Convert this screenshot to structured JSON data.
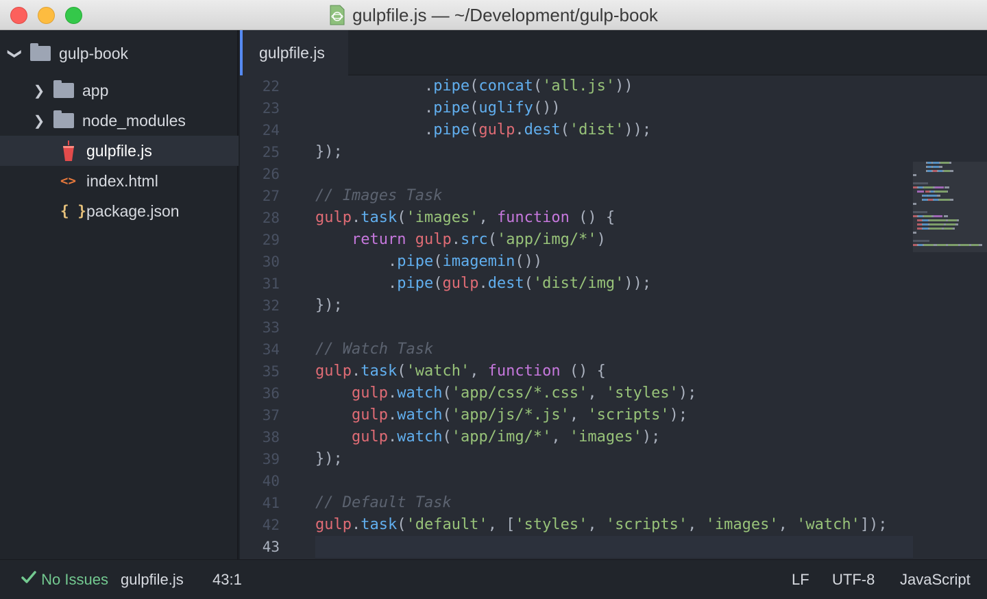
{
  "window": {
    "title": "gulpfile.js — ~/Development/gulp-book"
  },
  "sidebar": {
    "root": {
      "label": "gulp-book"
    },
    "items": [
      {
        "label": "app",
        "kind": "folder"
      },
      {
        "label": "node_modules",
        "kind": "folder"
      },
      {
        "label": "gulpfile.js",
        "kind": "gulp-file",
        "selected": true
      },
      {
        "label": "index.html",
        "kind": "html-file"
      },
      {
        "label": "package.json",
        "kind": "json-file"
      }
    ]
  },
  "icons": {
    "html": "<>",
    "json": "{ }"
  },
  "editor": {
    "active_tab": "gulpfile.js",
    "current_line": 43,
    "lines": [
      {
        "no": "22",
        "tokens": [
          [
            "p",
            "            ."
          ],
          [
            "f",
            "pipe"
          ],
          [
            "p",
            "("
          ],
          [
            "f",
            "concat"
          ],
          [
            "p",
            "("
          ],
          [
            "s",
            "'all.js'"
          ],
          [
            "p",
            "))"
          ]
        ]
      },
      {
        "no": "23",
        "tokens": [
          [
            "p",
            "            ."
          ],
          [
            "f",
            "pipe"
          ],
          [
            "p",
            "("
          ],
          [
            "f",
            "uglify"
          ],
          [
            "p",
            "())"
          ]
        ]
      },
      {
        "no": "24",
        "tokens": [
          [
            "p",
            "            ."
          ],
          [
            "f",
            "pipe"
          ],
          [
            "p",
            "("
          ],
          [
            "v",
            "gulp"
          ],
          [
            "p",
            "."
          ],
          [
            "f",
            "dest"
          ],
          [
            "p",
            "("
          ],
          [
            "s",
            "'dist'"
          ],
          [
            "p",
            "));"
          ]
        ]
      },
      {
        "no": "25",
        "tokens": [
          [
            "p",
            "});"
          ]
        ]
      },
      {
        "no": "26",
        "tokens": []
      },
      {
        "no": "27",
        "tokens": [
          [
            "c",
            "// Images Task"
          ]
        ]
      },
      {
        "no": "28",
        "tokens": [
          [
            "v",
            "gulp"
          ],
          [
            "p",
            "."
          ],
          [
            "f",
            "task"
          ],
          [
            "p",
            "("
          ],
          [
            "s",
            "'images'"
          ],
          [
            "p",
            ", "
          ],
          [
            "k",
            "function"
          ],
          [
            "p",
            " () {"
          ]
        ]
      },
      {
        "no": "29",
        "tokens": [
          [
            "p",
            "    "
          ],
          [
            "k",
            "return"
          ],
          [
            "p",
            " "
          ],
          [
            "v",
            "gulp"
          ],
          [
            "p",
            "."
          ],
          [
            "f",
            "src"
          ],
          [
            "p",
            "("
          ],
          [
            "s",
            "'app/img/*'"
          ],
          [
            "p",
            ")"
          ]
        ]
      },
      {
        "no": "30",
        "tokens": [
          [
            "p",
            "        ."
          ],
          [
            "f",
            "pipe"
          ],
          [
            "p",
            "("
          ],
          [
            "f",
            "imagemin"
          ],
          [
            "p",
            "())"
          ]
        ]
      },
      {
        "no": "31",
        "tokens": [
          [
            "p",
            "        ."
          ],
          [
            "f",
            "pipe"
          ],
          [
            "p",
            "("
          ],
          [
            "v",
            "gulp"
          ],
          [
            "p",
            "."
          ],
          [
            "f",
            "dest"
          ],
          [
            "p",
            "("
          ],
          [
            "s",
            "'dist/img'"
          ],
          [
            "p",
            "));"
          ]
        ]
      },
      {
        "no": "32",
        "tokens": [
          [
            "p",
            "});"
          ]
        ]
      },
      {
        "no": "33",
        "tokens": []
      },
      {
        "no": "34",
        "tokens": [
          [
            "c",
            "// Watch Task"
          ]
        ]
      },
      {
        "no": "35",
        "tokens": [
          [
            "v",
            "gulp"
          ],
          [
            "p",
            "."
          ],
          [
            "f",
            "task"
          ],
          [
            "p",
            "("
          ],
          [
            "s",
            "'watch'"
          ],
          [
            "p",
            ", "
          ],
          [
            "k",
            "function"
          ],
          [
            "p",
            " () {"
          ]
        ]
      },
      {
        "no": "36",
        "tokens": [
          [
            "p",
            "    "
          ],
          [
            "v",
            "gulp"
          ],
          [
            "p",
            "."
          ],
          [
            "f",
            "watch"
          ],
          [
            "p",
            "("
          ],
          [
            "s",
            "'app/css/*.css'"
          ],
          [
            "p",
            ", "
          ],
          [
            "s",
            "'styles'"
          ],
          [
            "p",
            ");"
          ]
        ]
      },
      {
        "no": "37",
        "tokens": [
          [
            "p",
            "    "
          ],
          [
            "v",
            "gulp"
          ],
          [
            "p",
            "."
          ],
          [
            "f",
            "watch"
          ],
          [
            "p",
            "("
          ],
          [
            "s",
            "'app/js/*.js'"
          ],
          [
            "p",
            ", "
          ],
          [
            "s",
            "'scripts'"
          ],
          [
            "p",
            ");"
          ]
        ]
      },
      {
        "no": "38",
        "tokens": [
          [
            "p",
            "    "
          ],
          [
            "v",
            "gulp"
          ],
          [
            "p",
            "."
          ],
          [
            "f",
            "watch"
          ],
          [
            "p",
            "("
          ],
          [
            "s",
            "'app/img/*'"
          ],
          [
            "p",
            ", "
          ],
          [
            "s",
            "'images'"
          ],
          [
            "p",
            ");"
          ]
        ]
      },
      {
        "no": "39",
        "tokens": [
          [
            "p",
            "});"
          ]
        ]
      },
      {
        "no": "40",
        "tokens": []
      },
      {
        "no": "41",
        "tokens": [
          [
            "c",
            "// Default Task"
          ]
        ]
      },
      {
        "no": "42",
        "tokens": [
          [
            "v",
            "gulp"
          ],
          [
            "p",
            "."
          ],
          [
            "f",
            "task"
          ],
          [
            "p",
            "("
          ],
          [
            "s",
            "'default'"
          ],
          [
            "p",
            ", ["
          ],
          [
            "s",
            "'styles'"
          ],
          [
            "p",
            ", "
          ],
          [
            "s",
            "'scripts'"
          ],
          [
            "p",
            ", "
          ],
          [
            "s",
            "'images'"
          ],
          [
            "p",
            ", "
          ],
          [
            "s",
            "'watch'"
          ],
          [
            "p",
            "]);"
          ]
        ]
      },
      {
        "no": "43",
        "tokens": []
      }
    ]
  },
  "status": {
    "issues": "No Issues",
    "file": "gulpfile.js",
    "position": "43:1",
    "line_ending": "LF",
    "encoding": "UTF-8",
    "grammar": "JavaScript"
  },
  "colors": {
    "accent": "#568af2",
    "string": "#98c379",
    "function": "#61afef",
    "variable": "#e06c75",
    "keyword": "#c678dd",
    "comment": "#5c6370",
    "ok": "#73c990"
  }
}
